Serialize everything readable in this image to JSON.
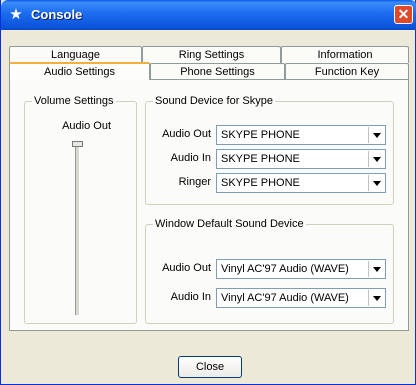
{
  "window": {
    "title": "Console",
    "close_glyph": "✕",
    "title_icon": "★"
  },
  "tabs_row1": [
    {
      "label": "Language"
    },
    {
      "label": "Ring Settings"
    },
    {
      "label": "Information"
    }
  ],
  "tabs_row2": [
    {
      "label": "Audio Settings"
    },
    {
      "label": "Phone Settings"
    },
    {
      "label": "Function Key"
    }
  ],
  "volume": {
    "legend": "Volume Settings",
    "audio_out_label": "Audio Out",
    "level": 1.0
  },
  "skype_device": {
    "legend": "Sound Device for Skype",
    "audio_out_label": "Audio Out",
    "audio_out_value": "SKYPE PHONE",
    "audio_in_label": "Audio In",
    "audio_in_value": "SKYPE PHONE",
    "ringer_label": "Ringer",
    "ringer_value": "SKYPE PHONE"
  },
  "default_device": {
    "legend": "Window Default Sound Device",
    "audio_out_label": "Audio Out",
    "audio_out_value": "Vinyl AC'97 Audio (WAVE)",
    "audio_in_label": "Audio In",
    "audio_in_value": "Vinyl AC'97 Audio (WAVE)"
  },
  "close_button": "Close"
}
